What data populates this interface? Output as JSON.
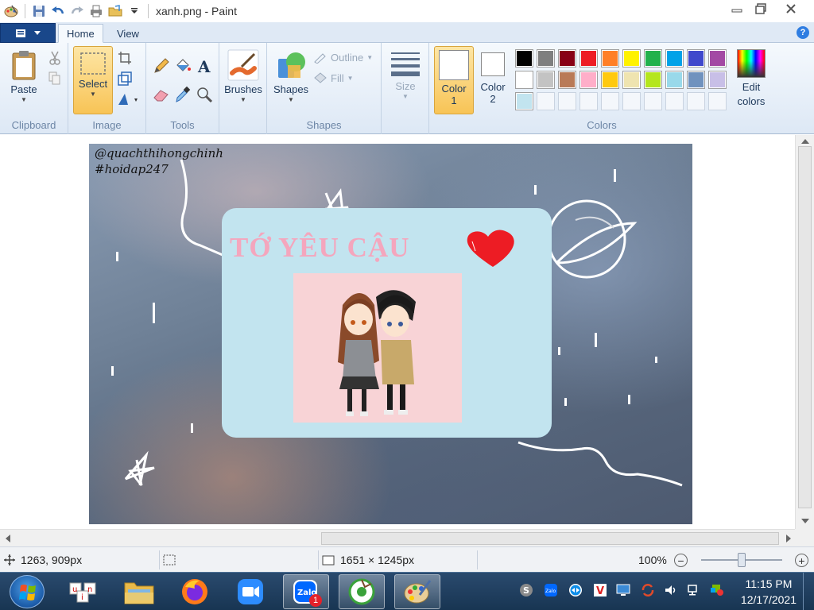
{
  "window": {
    "title": "xanh.png - Paint",
    "minimize_icon": "minimize-icon",
    "maximize_icon": "restore-icon",
    "close_icon": "close-icon"
  },
  "quick_access": [
    "paint-app-icon",
    "save-icon",
    "undo-icon",
    "redo-icon",
    "print-icon",
    "folder-icon",
    "customize-dropdown-icon"
  ],
  "tabs": {
    "home": "Home",
    "view": "View"
  },
  "help_label": "?",
  "ribbon": {
    "clipboard": {
      "group": "Clipboard",
      "paste": "Paste"
    },
    "image": {
      "group": "Image",
      "select": "Select"
    },
    "tools": {
      "group": "Tools"
    },
    "brushes": {
      "label": "Brushes"
    },
    "shapes": {
      "group": "Shapes",
      "shapes_label": "Shapes",
      "outline": "Outline",
      "fill": "Fill"
    },
    "size": {
      "label": "Size"
    },
    "colors": {
      "group": "Colors",
      "color1": "Color",
      "color1_num": "1",
      "color2": "Color",
      "color2_num": "2",
      "edit": "Edit",
      "edit2": "colors",
      "row1": [
        "#000000",
        "#7f7f7f",
        "#880015",
        "#ed1c24",
        "#ff7f27",
        "#fff200",
        "#22b14c",
        "#00a2e8",
        "#3f48cc",
        "#a349a4"
      ],
      "row2": [
        "#ffffff",
        "#c3c3c3",
        "#b97a57",
        "#ffaec9",
        "#ffc90e",
        "#efe4b0",
        "#b5e61d",
        "#99d9ea",
        "#7092be",
        "#c8bfe7"
      ],
      "row3": [
        "#c2e4ef"
      ]
    }
  },
  "picture": {
    "handle1": "@quachthihongchinh",
    "handle2": "#hoidap247",
    "card_title": "TỚ YÊU CẬU",
    "card_bg": "#c2e4ef",
    "title_color": "#f4a6bd",
    "heart_color": "#ed1c24"
  },
  "status": {
    "cursor_pos": "1263, 909px",
    "image_size": "1651 × 1245px",
    "zoom": "100%",
    "zoom_out": "−",
    "zoom_in": "+"
  },
  "taskbar": {
    "apps": [
      "unikey-icon",
      "file-explorer-icon",
      "firefox-icon",
      "zoom-icon",
      "zalo-icon",
      "coccoc-icon",
      "paint-icon"
    ],
    "zalo_badge": "1",
    "time": "11:15 PM",
    "date": "12/17/2021"
  }
}
